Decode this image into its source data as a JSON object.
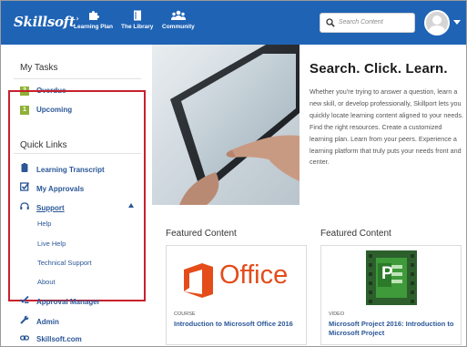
{
  "app": {
    "logo": "Skillsoft"
  },
  "topnav": {
    "items": [
      {
        "label": "Learning Plan",
        "icon": "puzzle-icon"
      },
      {
        "label": "The Library",
        "icon": "book-icon"
      },
      {
        "label": "Community",
        "icon": "people-icon"
      }
    ],
    "search_placeholder": "Search Content"
  },
  "sidebar": {
    "my_tasks_title": "My Tasks",
    "tasks": [
      {
        "count": "2",
        "label": "Overdue"
      },
      {
        "count": "1",
        "label": "Upcoming"
      }
    ],
    "quick_links_title": "Quick Links",
    "links": [
      {
        "label": "Learning Transcript",
        "icon": "clipboard-icon"
      },
      {
        "label": "My Approvals",
        "icon": "checkbox-icon"
      },
      {
        "label": "Support",
        "icon": "headset-icon"
      },
      {
        "label": "Approval Manager",
        "icon": "check-list-icon"
      },
      {
        "label": "Admin",
        "icon": "wrench-icon"
      },
      {
        "label": "Skillsoft.com",
        "icon": "link-icon"
      }
    ],
    "support_sublinks": [
      "Help",
      "Live Help",
      "Technical Support",
      "About"
    ]
  },
  "hero": {
    "title": "Search. Click. Learn.",
    "text": "Whether you're trying to answer a question, learn a new skill, or develop professionally, Skillport lets you quickly locate learning content aligned to your needs. Find the right resources. Create a customized learning plan. Learn from your peers. Experience a learning platform that truly puts your needs front and center."
  },
  "featured": [
    {
      "section_title": "Featured Content",
      "type": "COURSE",
      "name": "Introduction to Microsoft Office 2016",
      "image_text": "Office"
    },
    {
      "section_title": "Featured Content",
      "type": "VIDEO",
      "name": "Microsoft Project 2016: Introduction to Microsoft Project",
      "image_text": "P"
    }
  ],
  "colors": {
    "topbar": "#1f63b5",
    "link": "#2b5797",
    "badge": "#8fb136",
    "highlight_box": "#c8202e",
    "office": "#e44c1a",
    "project": "#2f6a2e"
  }
}
